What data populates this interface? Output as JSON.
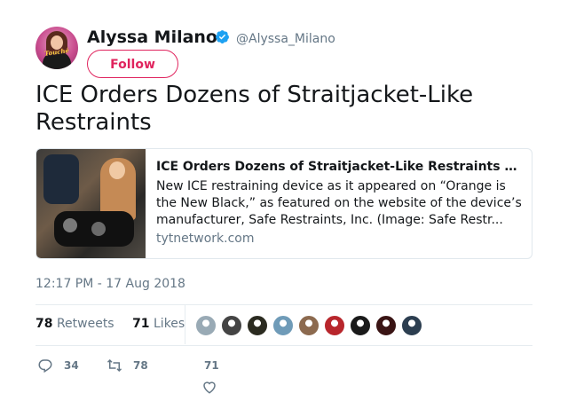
{
  "author": {
    "display_name": "Alyssa Milano",
    "handle": "@Alyssa_Milano",
    "verified": true,
    "avatar_logo_text": "Touché",
    "avatar_icon": "profile-avatar"
  },
  "follow_button": {
    "label": "Follow"
  },
  "tweet": {
    "text": "ICE Orders Dozens of Straitjacket-Like Restraints"
  },
  "card": {
    "title": "ICE Orders Dozens of Straitjacket-Like Restraints -...",
    "description": "New ICE restraining device as it appeared on “Orange is the New Black,” as featured on the website of the device’s manufacturer, Safe Restraints, Inc. (Image: Safe Restr...",
    "domain": "tytnetwork.com"
  },
  "timestamp": "12:17 PM - 17 Aug 2018",
  "stats": {
    "retweets_count": "78",
    "retweets_label": "Retweets",
    "likes_count": "71",
    "likes_label": "Likes"
  },
  "likers": [
    {
      "icon": "default-avatar",
      "color": "#99aab5"
    },
    {
      "icon": "user-avatar",
      "color": "#444444"
    },
    {
      "icon": "user-avatar",
      "color": "#2b2b20"
    },
    {
      "icon": "user-avatar",
      "color": "#6f9bb8"
    },
    {
      "icon": "user-avatar",
      "color": "#8c6a4f"
    },
    {
      "icon": "user-avatar",
      "color": "#b8262c"
    },
    {
      "icon": "user-avatar",
      "color": "#1a1a1a"
    },
    {
      "icon": "user-avatar",
      "color": "#3a1414"
    },
    {
      "icon": "user-avatar",
      "color": "#2c3e50"
    }
  ],
  "actions": {
    "reply_count": "34",
    "retweet_count": "78",
    "like_count": "71"
  },
  "colors": {
    "accent": "#e0245e",
    "verified_blue": "#1da1f2",
    "muted": "#657786"
  }
}
